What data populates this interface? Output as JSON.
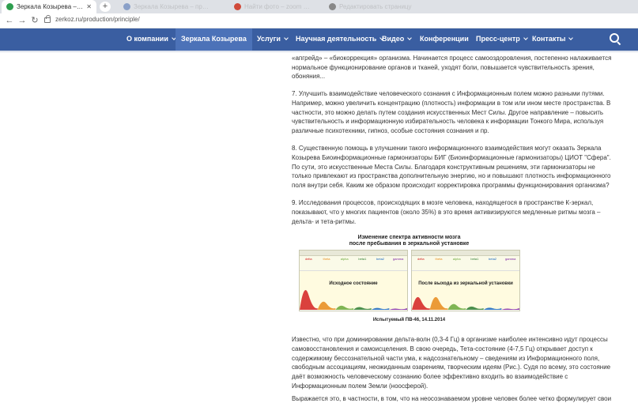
{
  "browser": {
    "tabs": [
      {
        "title": "Зеркала Козырева – принцип д",
        "active": true,
        "favicon_color": "#2e9e4f"
      },
      {
        "title": "Зеркала Козырева – принцип",
        "active": false,
        "favicon_color": "#8aa0c8"
      },
      {
        "title": "Найти фото – zoom 06.16",
        "active": false,
        "favicon_color": "#d04a3a"
      },
      {
        "title": "Редактировать страницу",
        "active": false,
        "favicon_color": "#888888"
      }
    ],
    "new_tab_label": "+",
    "url": "zerkoz.ru/production/principle/"
  },
  "site_nav": {
    "items": [
      {
        "label": "О компании",
        "caret": true,
        "active": false
      },
      {
        "label": "Зеркала Козырева",
        "caret": false,
        "active": true
      },
      {
        "label": "Услуги",
        "caret": true,
        "active": false
      },
      {
        "label": "Научная деятельность",
        "caret": true,
        "active": false
      },
      {
        "label": "Видео",
        "caret": true,
        "active": false
      },
      {
        "label": "Конференции",
        "caret": false,
        "active": false
      },
      {
        "label": "Пресс-центр",
        "caret": true,
        "active": false
      },
      {
        "label": "Контакты",
        "caret": true,
        "active": false
      }
    ]
  },
  "article": {
    "p0": "энергетические потоки в организме начинают налаживаться. Результатом этого является последующий «апгрейд» – «биокоррекция» организма. Начинается процесс самооздоровления, постепенно налаживается нормальное функционирование органов и тканей, уходят боли, повышается чувствительность зрения, обоняния...",
    "p7": "7. Улучшить взаимодействие человеческого сознания с Информационным полем можно разными путями. Например, можно увеличить концентрацию (плотность) информации в том или ином месте пространства. В частности, это можно делать путем создания искусственных Мест Силы. Другое направление – повысить чувствительность и информационную избирательность человека к информации Тонкого Мира, используя различные психотехники, гипноз, особые состояния сознания и пр.",
    "p8": "8. Существенную помощь в улучшении такого информационного взаимодействия могут оказать Зеркала Козырева Биоинформационные гармонизаторы БИГ (Биоинформационные гармонизаторы) ЦИОТ \"Сфера\". По сути, это искусственные Места Силы. Благодаря конструктивным решениям, эти гармонизаторы не только привлекают из пространства дополнительную энергию, но и повышают плотность информационного поля внутри себя. Каким же образом происходит корректировка программы функционирования организма?",
    "p9": "9. Исследования процессов, происходящих в мозге человека, находящегося в пространстве К-зеркал, показывают, что у многих пациентов (около 35%) в это время активизируются медленные ритмы мозга – дельта- и тета-ритмы.",
    "p10": "Известно, что при доминировании дельта-волн (0,3-4 Гц) в организме наиболее интенсивно идут процессы самовосстановления и самоисцеления. В свою очередь, Тета-состояние (4-7,5 Гц) открывает доступ к содержимому бессознательной части ума, к надсознательному – сведениям из Информационного поля, свободным ассоциациям, неожиданным озарениям, творческим идеям (Рис.). Судя по всему, это состояние даёт возможность человеческому сознанию более эффективно входить во взаимодействие с Информационным полем Земли (ноосферой).",
    "p11": "Выражается это, в частности, в том, что на неосознаваемом уровне человек более четко формулирует свои"
  },
  "figure": {
    "title_line1": "Изменение спектра активности мозга",
    "title_line2": "после пребывания в зеркальной установке",
    "panel_left_label": "Исходное состояние",
    "panel_right_label": "После выхода из зеркальной установки",
    "caption": "Испытуемый ПВ-46, 14.11.2014",
    "band_names": [
      "delta",
      "theta",
      "alpha",
      "beta1",
      "beta2",
      "gamma"
    ],
    "band_colors": [
      "#d32020",
      "#e88a1a",
      "#6aa83a",
      "#2e7d32",
      "#1565c0",
      "#7b1fa2"
    ],
    "left_peaks": [
      0.85,
      0.35,
      0.18,
      0.12,
      0.08,
      0.05
    ],
    "right_peaks": [
      0.55,
      0.55,
      0.25,
      0.14,
      0.09,
      0.05
    ]
  }
}
